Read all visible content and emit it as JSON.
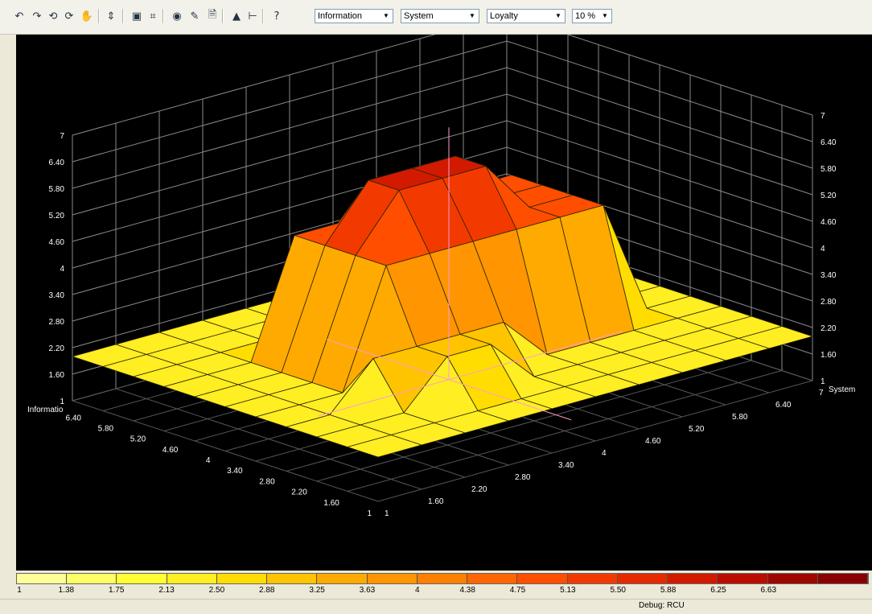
{
  "toolbar": {
    "buttons": [
      {
        "icon": "rotate-left-icon",
        "glyph": "↶"
      },
      {
        "icon": "rotate-right-icon",
        "glyph": "↷"
      },
      {
        "icon": "tilt-up-icon",
        "glyph": "⟲"
      },
      {
        "icon": "tilt-down-icon",
        "glyph": "⟳"
      },
      {
        "icon": "pan-hand-icon",
        "glyph": "✋"
      },
      {
        "icon": "axis-settings-icon",
        "glyph": "⇕"
      },
      {
        "icon": "frame-icon",
        "glyph": "▣"
      },
      {
        "icon": "wireframe-icon",
        "glyph": "⌗"
      },
      {
        "icon": "view-icon",
        "glyph": "◉"
      },
      {
        "icon": "paint-icon",
        "glyph": "✎"
      },
      {
        "icon": "document-icon",
        "glyph": "🗎"
      },
      {
        "icon": "export-icon",
        "glyph": "▲"
      },
      {
        "icon": "cursor-icon",
        "glyph": "⊢"
      },
      {
        "icon": "help-icon",
        "glyph": "?"
      }
    ],
    "combos": [
      {
        "name": "x-axis-select",
        "value": "Information"
      },
      {
        "name": "y-axis-select",
        "value": "System"
      },
      {
        "name": "z-axis-select",
        "value": "Loyalty"
      },
      {
        "name": "zoom-select",
        "value": "10 %"
      }
    ]
  },
  "chart_data": {
    "type": "surface",
    "axes": {
      "x": {
        "label": "Informatio",
        "range": [
          1,
          7
        ],
        "ticks": [
          "1",
          "1.60",
          "2.20",
          "2.80",
          "3.40",
          "4",
          "4.60",
          "5.20",
          "5.80",
          "6.40"
        ]
      },
      "y": {
        "label": "System",
        "range": [
          1,
          7
        ],
        "ticks": [
          "1",
          "1.60",
          "2.20",
          "2.80",
          "3.40",
          "4",
          "4.60",
          "5.20",
          "5.80",
          "6.40",
          "7"
        ]
      },
      "z": {
        "label": "Loyalty",
        "range": [
          1,
          7
        ],
        "ticks_left": [
          "1",
          "1.60",
          "2.20",
          "2.80",
          "3.40",
          "4",
          "4.60",
          "5.20",
          "5.80",
          "6.40",
          "7"
        ],
        "ticks_right": [
          "1",
          "1.60",
          "2.20",
          "2.80",
          "3.40",
          "4",
          "4.60",
          "5.20",
          "5.80",
          "6.40",
          "7"
        ]
      }
    },
    "grid": true,
    "surface_levels": {
      "base": 2,
      "middle_orange": 3,
      "plateau_yellow": 4.6,
      "top_red": 5.8
    },
    "series": [
      {
        "description_levels": [
          [
            2,
            2,
            2,
            2,
            2,
            2,
            2,
            2,
            2,
            2,
            2
          ],
          [
            2,
            2,
            2,
            2,
            2,
            2,
            2,
            2,
            2,
            2,
            2
          ],
          [
            2,
            2,
            2,
            2,
            2,
            2,
            2,
            2,
            2,
            2,
            2
          ],
          [
            2,
            2,
            2,
            4.6,
            4.6,
            4.6,
            4.6,
            4.6,
            4.6,
            2,
            2
          ],
          [
            2,
            2,
            2,
            4.6,
            5.8,
            5.8,
            5.8,
            4.6,
            4.6,
            2,
            2
          ],
          [
            2,
            2,
            2,
            4.6,
            5.8,
            5.8,
            5.8,
            4.6,
            4.6,
            2,
            2
          ],
          [
            2,
            2,
            2,
            4.6,
            4.6,
            4.6,
            4.6,
            4.6,
            4.6,
            2,
            2
          ],
          [
            2,
            2,
            3,
            3,
            3,
            3,
            2,
            2,
            2,
            2,
            2
          ],
          [
            2,
            2,
            2,
            3,
            3,
            2,
            2,
            2,
            2,
            2,
            2
          ],
          [
            2,
            2,
            2,
            2,
            2,
            2,
            2,
            2,
            2,
            2,
            2
          ],
          [
            2,
            2,
            2,
            2,
            2,
            2,
            2,
            2,
            2,
            2,
            2
          ]
        ]
      }
    ]
  },
  "legend": {
    "colors": [
      "#ffff99",
      "#ffff66",
      "#ffff33",
      "#ffee22",
      "#ffdd00",
      "#ffc400",
      "#ffaa00",
      "#ff9500",
      "#ff7f00",
      "#ff6500",
      "#ff4e00",
      "#f23a00",
      "#e52a00",
      "#d11a00",
      "#bb0c00",
      "#a00600",
      "#8a0000"
    ],
    "labels": [
      "1",
      "1.38",
      "1.75",
      "2.13",
      "2.50",
      "2.88",
      "3.25",
      "3.63",
      "4",
      "4.38",
      "4.75",
      "5.13",
      "5.50",
      "5.88",
      "6.25",
      "6.63"
    ]
  },
  "status": {
    "text": "Debug: RCU"
  }
}
